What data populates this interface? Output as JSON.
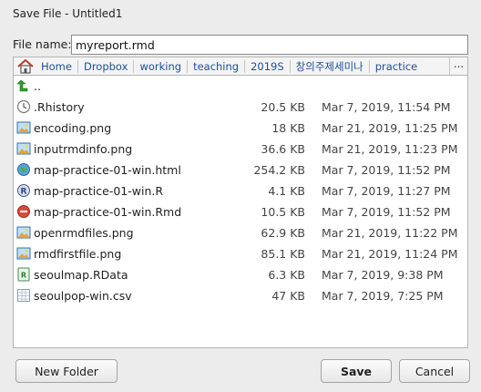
{
  "window": {
    "title": "Save File - Untitled1"
  },
  "filename": {
    "label": "File name:",
    "value": "myreport.rmd"
  },
  "breadcrumb": {
    "items": [
      "Home",
      "Dropbox",
      "working",
      "teaching",
      "2019S",
      "창의주제세미나",
      "practice"
    ],
    "more": "..."
  },
  "files": [
    {
      "name": "..",
      "size": "",
      "date": "",
      "icon": "up-arrow-icon"
    },
    {
      "name": ".Rhistory",
      "size": "20.5 KB",
      "date": "Mar 7, 2019, 11:54 PM",
      "icon": "history-file-icon"
    },
    {
      "name": "encoding.png",
      "size": "18 KB",
      "date": "Mar 21, 2019, 11:25 PM",
      "icon": "image-file-icon"
    },
    {
      "name": "inputrmdinfo.png",
      "size": "36.6 KB",
      "date": "Mar 21, 2019, 11:23 PM",
      "icon": "image-file-icon"
    },
    {
      "name": "map-practice-01-win.html",
      "size": "254.2 KB",
      "date": "Mar 7, 2019, 11:52 PM",
      "icon": "html-file-icon"
    },
    {
      "name": "map-practice-01-win.R",
      "size": "4.1 KB",
      "date": "Mar 7, 2019, 11:27 PM",
      "icon": "r-script-icon"
    },
    {
      "name": "map-practice-01-win.Rmd",
      "size": "10.5 KB",
      "date": "Mar 7, 2019, 11:52 PM",
      "icon": "rmd-file-icon"
    },
    {
      "name": "openrmdfiles.png",
      "size": "62.9 KB",
      "date": "Mar 21, 2019, 11:22 PM",
      "icon": "image-file-icon"
    },
    {
      "name": "rmdfirstfile.png",
      "size": "85.1 KB",
      "date": "Mar 21, 2019, 11:24 PM",
      "icon": "image-file-icon"
    },
    {
      "name": "seoulmap.RData",
      "size": "6.3 KB",
      "date": "Mar 7, 2019, 9:38 PM",
      "icon": "rdata-file-icon"
    },
    {
      "name": "seoulpop-win.csv",
      "size": "47 KB",
      "date": "Mar 7, 2019, 7:25 PM",
      "icon": "csv-file-icon"
    }
  ],
  "buttons": {
    "new_folder": "New Folder",
    "save": "Save",
    "cancel": "Cancel"
  },
  "colors": {
    "link": "#1d4f9a",
    "background": "#ececec",
    "list_bg": "#ffffff"
  }
}
